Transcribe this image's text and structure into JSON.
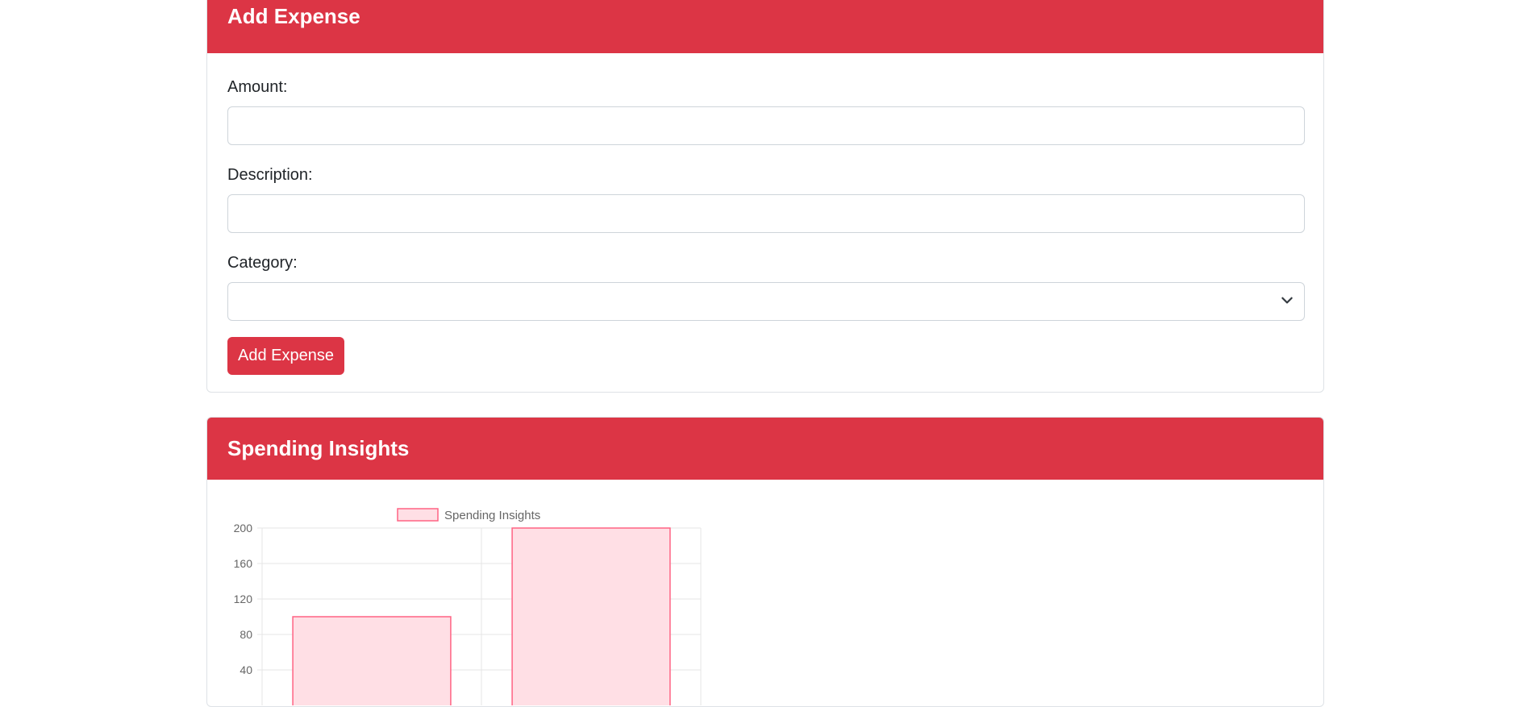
{
  "add_expense_card": {
    "title": "Add Expense",
    "amount_label": "Amount:",
    "amount_value": "",
    "description_label": "Description:",
    "description_value": "",
    "category_label": "Category:",
    "category_selected": "",
    "submit_label": "Add Expense"
  },
  "insights_card": {
    "title": "Spending Insights"
  },
  "colors": {
    "accent": "#dc3545",
    "bar_fill": "#ffdfe5",
    "bar_stroke": "#ff6384",
    "grid": "#e5e5e5",
    "tick_text": "#666666"
  },
  "chart_data": {
    "type": "bar",
    "title": "",
    "legend": "Spending Insights",
    "legend_position": "top",
    "series": [
      {
        "name": "Spending Insights",
        "values": [
          100,
          200
        ]
      }
    ],
    "y_ticks": [
      200,
      160,
      120,
      80,
      40
    ],
    "ylim": [
      0,
      200
    ],
    "grid": true
  }
}
